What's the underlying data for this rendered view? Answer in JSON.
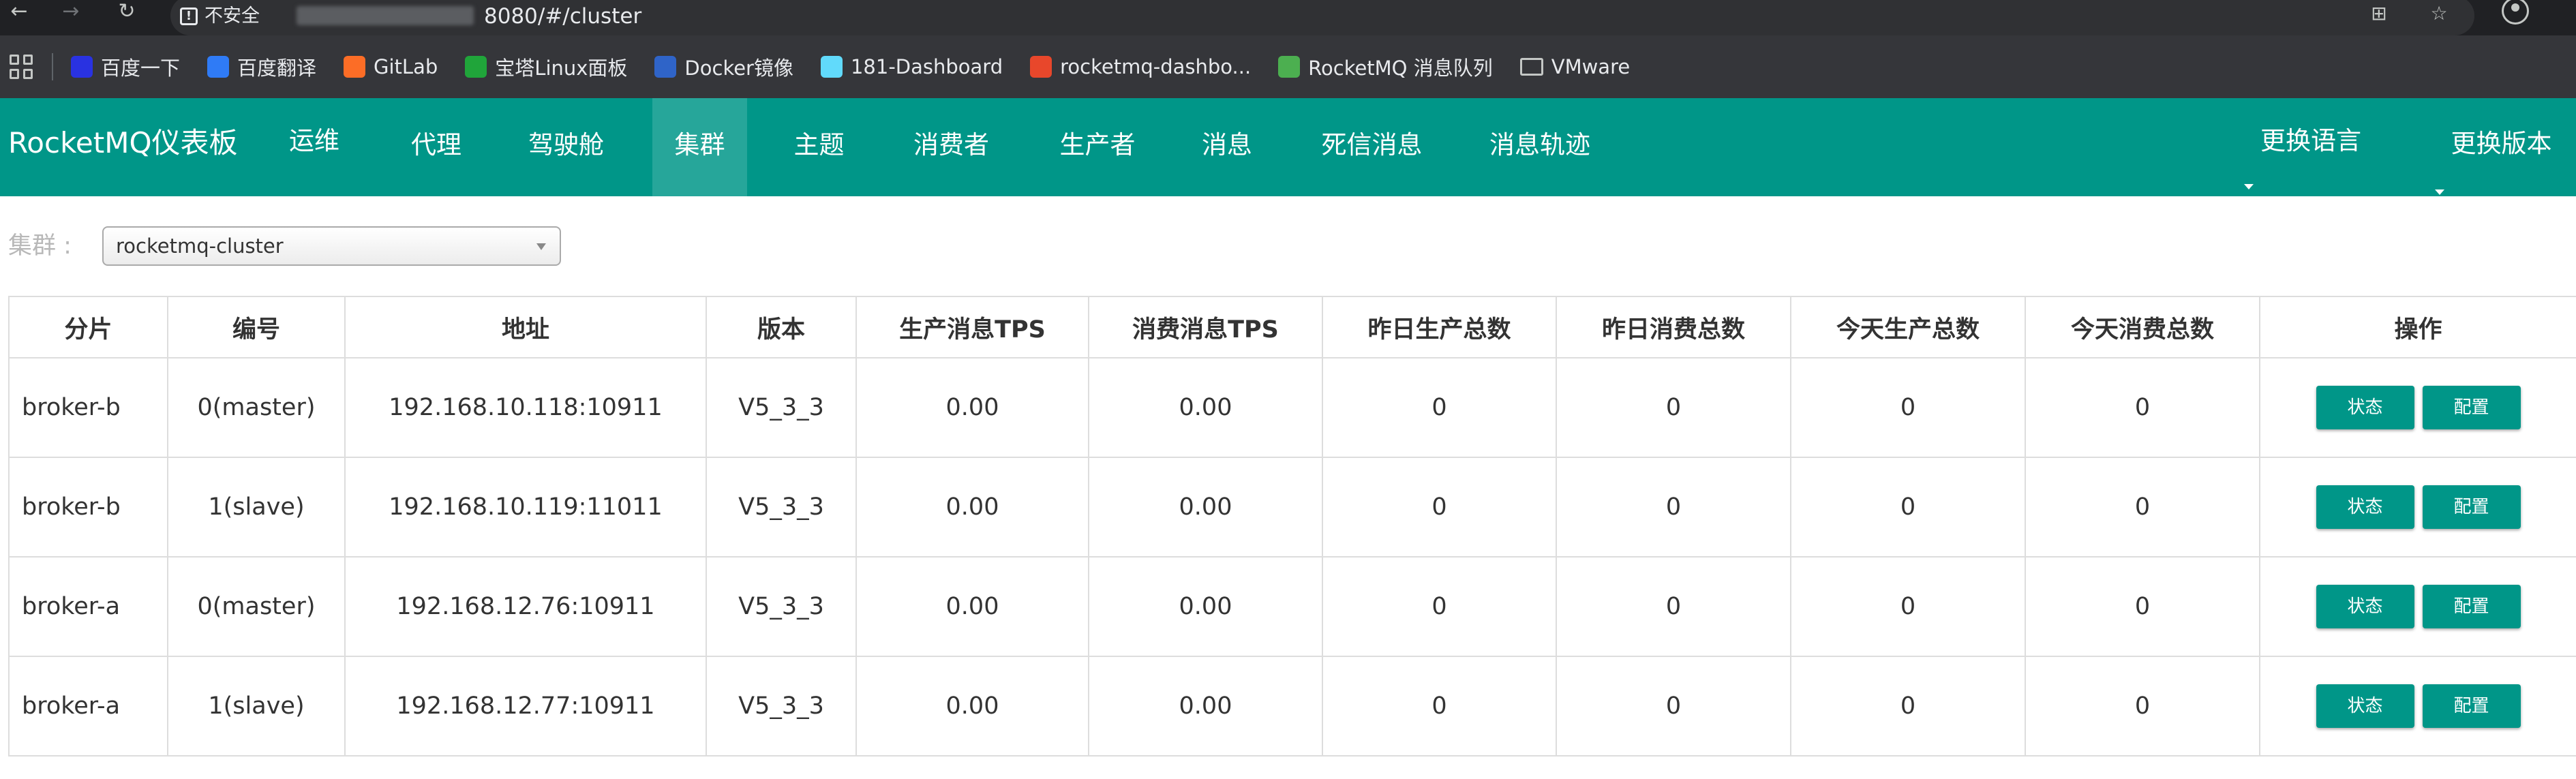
{
  "browser": {
    "security_label": "不安全",
    "url": "8080/#/cluster",
    "bookmarks": [
      {
        "label": "百度一下",
        "icon": "baidu-icon",
        "color": "#2932e1"
      },
      {
        "label": "百度翻译",
        "icon": "baidu-translate-icon",
        "color": "#2f7bf6"
      },
      {
        "label": "GitLab",
        "icon": "gitlab-icon",
        "color": "#fc6d26"
      },
      {
        "label": "宝塔Linux面板",
        "icon": "baota-icon",
        "color": "#20a53a"
      },
      {
        "label": "Docker镜像",
        "icon": "docker-icon",
        "color": "#2f64c8"
      },
      {
        "label": "181-Dashboard",
        "icon": "react-icon",
        "color": "#61dafb"
      },
      {
        "label": "rocketmq-dashbo...",
        "icon": "rocketmq-icon",
        "color": "#e8472b"
      },
      {
        "label": "RocketMQ 消息队列",
        "icon": "rocketmq-docs-icon",
        "color": "#4caf50"
      },
      {
        "label": "VMware",
        "icon": "folder-icon",
        "color": "#c4c7c5"
      }
    ]
  },
  "navbar": {
    "brand": "RocketMQ仪表板",
    "items": [
      "运维",
      "代理",
      "驾驶舱",
      "集群",
      "主题",
      "消费者",
      "生产者",
      "消息",
      "死信消息",
      "消息轨迹"
    ],
    "active": "集群",
    "language_label": "更换语言",
    "version_label": "更换版本",
    "accent_color": "#009688"
  },
  "cluster": {
    "label": "集群 :",
    "selected": "rocketmq-cluster"
  },
  "table": {
    "headers": [
      "分片",
      "编号",
      "地址",
      "版本",
      "生产消息TPS",
      "消费消息TPS",
      "昨日生产总数",
      "昨日消费总数",
      "今天生产总数",
      "今天消费总数",
      "操作"
    ],
    "rows": [
      {
        "shard": "broker-b",
        "id": "0(master)",
        "address": "192.168.10.118:10911",
        "version": "V5_3_3",
        "produce_tps": "0.00",
        "consume_tps": "0.00",
        "yesterday_produce": "0",
        "yesterday_consume": "0",
        "today_produce": "0",
        "today_consume": "0"
      },
      {
        "shard": "broker-b",
        "id": "1(slave)",
        "address": "192.168.10.119:11011",
        "version": "V5_3_3",
        "produce_tps": "0.00",
        "consume_tps": "0.00",
        "yesterday_produce": "0",
        "yesterday_consume": "0",
        "today_produce": "0",
        "today_consume": "0"
      },
      {
        "shard": "broker-a",
        "id": "0(master)",
        "address": "192.168.12.76:10911",
        "version": "V5_3_3",
        "produce_tps": "0.00",
        "consume_tps": "0.00",
        "yesterday_produce": "0",
        "yesterday_consume": "0",
        "today_produce": "0",
        "today_consume": "0"
      },
      {
        "shard": "broker-a",
        "id": "1(slave)",
        "address": "192.168.12.77:10911",
        "version": "V5_3_3",
        "produce_tps": "0.00",
        "consume_tps": "0.00",
        "yesterday_produce": "0",
        "yesterday_consume": "0",
        "today_produce": "0",
        "today_consume": "0"
      }
    ],
    "status_button": "状态",
    "config_button": "配置"
  }
}
